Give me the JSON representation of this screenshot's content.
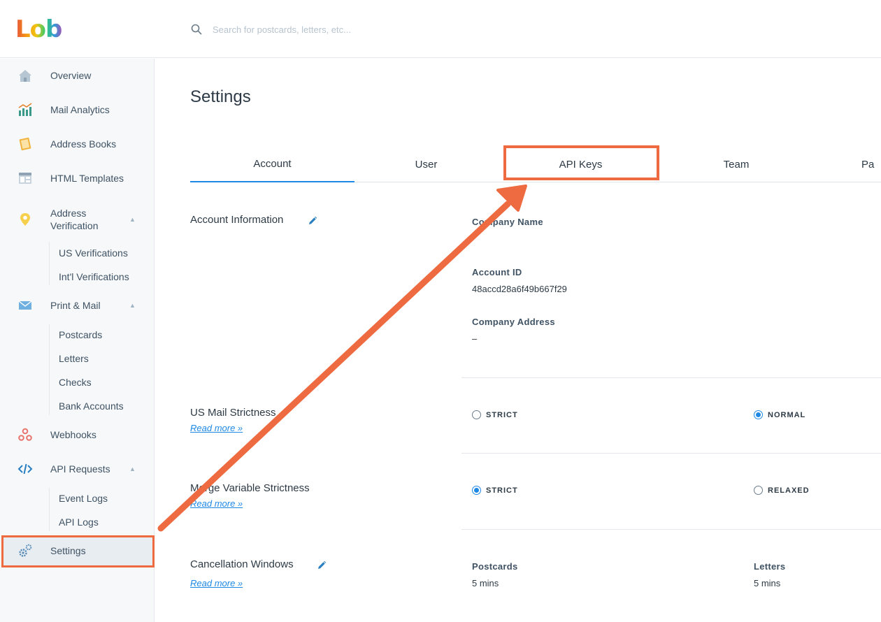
{
  "app": {
    "logo": "Lob"
  },
  "search": {
    "placeholder": "Search for postcards, letters, etc..."
  },
  "sidebar": {
    "items": [
      {
        "label": "Overview"
      },
      {
        "label": "Mail Analytics"
      },
      {
        "label": "Address Books"
      },
      {
        "label": "HTML Templates"
      },
      {
        "label": "Address Verification"
      },
      {
        "label": "Print & Mail"
      },
      {
        "label": "Webhooks"
      },
      {
        "label": "API Requests"
      },
      {
        "label": "Settings"
      }
    ],
    "address_verification_sub": [
      "US Verifications",
      "Int'l Verifications"
    ],
    "print_mail_sub": [
      "Postcards",
      "Letters",
      "Checks",
      "Bank Accounts"
    ],
    "api_requests_sub": [
      "Event Logs",
      "API Logs"
    ]
  },
  "page": {
    "title": "Settings",
    "tabs": [
      "Account",
      "User",
      "API Keys",
      "Team",
      "Pa"
    ]
  },
  "account": {
    "section_label": "Account Information",
    "company_name_label": "Company Name",
    "account_id_label": "Account ID",
    "account_id_value": "48accd28a6f49b667f29",
    "company_address_label": "Company Address",
    "company_address_value": "–"
  },
  "us_mail": {
    "label": "US Mail Strictness",
    "read_more": "Read more »",
    "option_a": "STRICT",
    "option_b": "NORMAL",
    "selected": "NORMAL"
  },
  "merge_var": {
    "label": "Merge Variable Strictness",
    "read_more": "Read more »",
    "option_a": "STRICT",
    "option_b": "RELAXED",
    "selected": "STRICT"
  },
  "cancel": {
    "label": "Cancellation Windows",
    "read_more": "Read more »",
    "postcards_label": "Postcards",
    "postcards_value": "5 mins",
    "letters_label": "Letters",
    "letters_value": "5 mins"
  },
  "colors": {
    "accent": "#1e88e5",
    "annotation": "#ee6a40"
  }
}
